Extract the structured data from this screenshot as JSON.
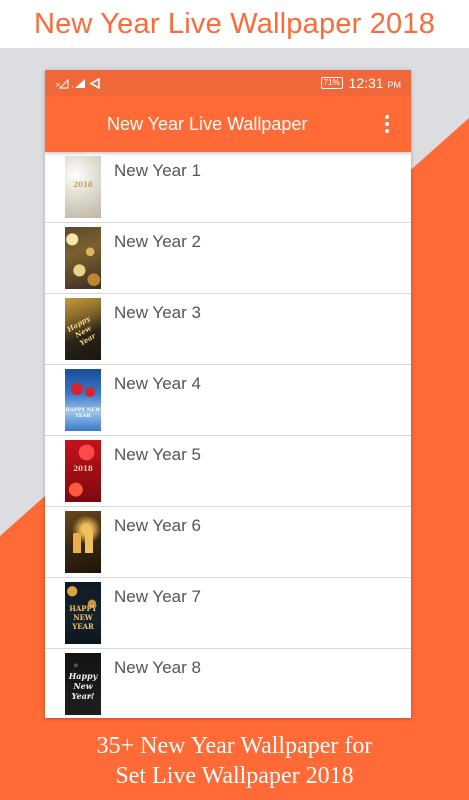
{
  "promo": {
    "title": "New Year Live Wallpaper 2018",
    "caption_line1": "35+ New Year Wallpaper for",
    "caption_line2": "Set Live Wallpaper 2018"
  },
  "status_bar": {
    "battery": "71%",
    "time": "12:31",
    "time_suffix": "PM"
  },
  "app_bar": {
    "title": "New Year Live Wallpaper",
    "menu_icon": "more-vert-icon"
  },
  "colors": {
    "accent": "#ff6a36",
    "status_bar": "#f0683a",
    "background_gray": "#dcdde1"
  },
  "items": [
    {
      "label": "New Year 1",
      "thumb_text": "2018"
    },
    {
      "label": "New Year 2",
      "thumb_text": ""
    },
    {
      "label": "New Year 3",
      "thumb_text": "Happy New Year"
    },
    {
      "label": "New Year 4",
      "thumb_text": "HAPPY NEW YEAR"
    },
    {
      "label": "New Year 5",
      "thumb_text": "2018"
    },
    {
      "label": "New Year 6",
      "thumb_text": ""
    },
    {
      "label": "New Year 7",
      "thumb_text": "HAPPY NEW YEAR"
    },
    {
      "label": "New Year 8",
      "thumb_text": "Happy New Year!"
    }
  ]
}
